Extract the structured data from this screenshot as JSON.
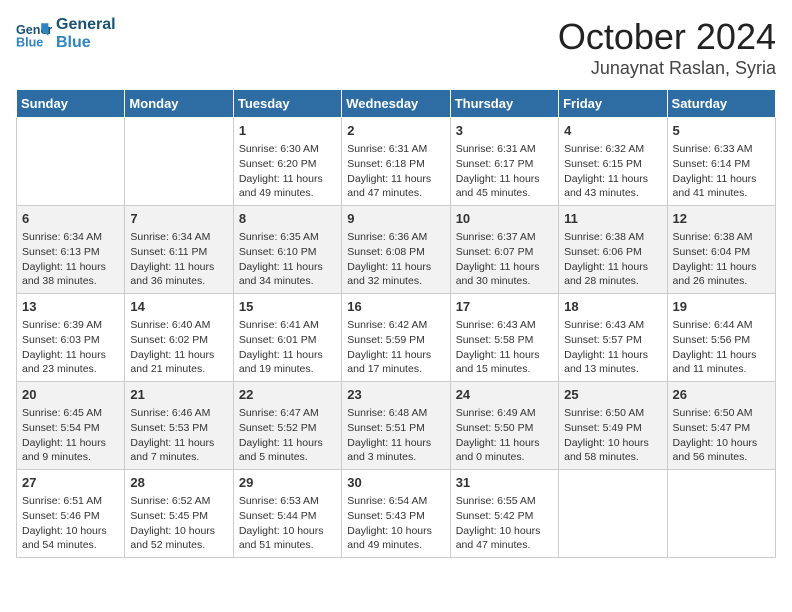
{
  "header": {
    "logo_line1": "General",
    "logo_line2": "Blue",
    "month": "October 2024",
    "location": "Junaynat Raslan, Syria"
  },
  "columns": [
    "Sunday",
    "Monday",
    "Tuesday",
    "Wednesday",
    "Thursday",
    "Friday",
    "Saturday"
  ],
  "weeks": [
    [
      {
        "day": "",
        "empty": true
      },
      {
        "day": "",
        "empty": true
      },
      {
        "day": "1",
        "sunrise": "Sunrise: 6:30 AM",
        "sunset": "Sunset: 6:20 PM",
        "daylight": "Daylight: 11 hours and 49 minutes."
      },
      {
        "day": "2",
        "sunrise": "Sunrise: 6:31 AM",
        "sunset": "Sunset: 6:18 PM",
        "daylight": "Daylight: 11 hours and 47 minutes."
      },
      {
        "day": "3",
        "sunrise": "Sunrise: 6:31 AM",
        "sunset": "Sunset: 6:17 PM",
        "daylight": "Daylight: 11 hours and 45 minutes."
      },
      {
        "day": "4",
        "sunrise": "Sunrise: 6:32 AM",
        "sunset": "Sunset: 6:15 PM",
        "daylight": "Daylight: 11 hours and 43 minutes."
      },
      {
        "day": "5",
        "sunrise": "Sunrise: 6:33 AM",
        "sunset": "Sunset: 6:14 PM",
        "daylight": "Daylight: 11 hours and 41 minutes."
      }
    ],
    [
      {
        "day": "6",
        "sunrise": "Sunrise: 6:34 AM",
        "sunset": "Sunset: 6:13 PM",
        "daylight": "Daylight: 11 hours and 38 minutes."
      },
      {
        "day": "7",
        "sunrise": "Sunrise: 6:34 AM",
        "sunset": "Sunset: 6:11 PM",
        "daylight": "Daylight: 11 hours and 36 minutes."
      },
      {
        "day": "8",
        "sunrise": "Sunrise: 6:35 AM",
        "sunset": "Sunset: 6:10 PM",
        "daylight": "Daylight: 11 hours and 34 minutes."
      },
      {
        "day": "9",
        "sunrise": "Sunrise: 6:36 AM",
        "sunset": "Sunset: 6:08 PM",
        "daylight": "Daylight: 11 hours and 32 minutes."
      },
      {
        "day": "10",
        "sunrise": "Sunrise: 6:37 AM",
        "sunset": "Sunset: 6:07 PM",
        "daylight": "Daylight: 11 hours and 30 minutes."
      },
      {
        "day": "11",
        "sunrise": "Sunrise: 6:38 AM",
        "sunset": "Sunset: 6:06 PM",
        "daylight": "Daylight: 11 hours and 28 minutes."
      },
      {
        "day": "12",
        "sunrise": "Sunrise: 6:38 AM",
        "sunset": "Sunset: 6:04 PM",
        "daylight": "Daylight: 11 hours and 26 minutes."
      }
    ],
    [
      {
        "day": "13",
        "sunrise": "Sunrise: 6:39 AM",
        "sunset": "Sunset: 6:03 PM",
        "daylight": "Daylight: 11 hours and 23 minutes."
      },
      {
        "day": "14",
        "sunrise": "Sunrise: 6:40 AM",
        "sunset": "Sunset: 6:02 PM",
        "daylight": "Daylight: 11 hours and 21 minutes."
      },
      {
        "day": "15",
        "sunrise": "Sunrise: 6:41 AM",
        "sunset": "Sunset: 6:01 PM",
        "daylight": "Daylight: 11 hours and 19 minutes."
      },
      {
        "day": "16",
        "sunrise": "Sunrise: 6:42 AM",
        "sunset": "Sunset: 5:59 PM",
        "daylight": "Daylight: 11 hours and 17 minutes."
      },
      {
        "day": "17",
        "sunrise": "Sunrise: 6:43 AM",
        "sunset": "Sunset: 5:58 PM",
        "daylight": "Daylight: 11 hours and 15 minutes."
      },
      {
        "day": "18",
        "sunrise": "Sunrise: 6:43 AM",
        "sunset": "Sunset: 5:57 PM",
        "daylight": "Daylight: 11 hours and 13 minutes."
      },
      {
        "day": "19",
        "sunrise": "Sunrise: 6:44 AM",
        "sunset": "Sunset: 5:56 PM",
        "daylight": "Daylight: 11 hours and 11 minutes."
      }
    ],
    [
      {
        "day": "20",
        "sunrise": "Sunrise: 6:45 AM",
        "sunset": "Sunset: 5:54 PM",
        "daylight": "Daylight: 11 hours and 9 minutes."
      },
      {
        "day": "21",
        "sunrise": "Sunrise: 6:46 AM",
        "sunset": "Sunset: 5:53 PM",
        "daylight": "Daylight: 11 hours and 7 minutes."
      },
      {
        "day": "22",
        "sunrise": "Sunrise: 6:47 AM",
        "sunset": "Sunset: 5:52 PM",
        "daylight": "Daylight: 11 hours and 5 minutes."
      },
      {
        "day": "23",
        "sunrise": "Sunrise: 6:48 AM",
        "sunset": "Sunset: 5:51 PM",
        "daylight": "Daylight: 11 hours and 3 minutes."
      },
      {
        "day": "24",
        "sunrise": "Sunrise: 6:49 AM",
        "sunset": "Sunset: 5:50 PM",
        "daylight": "Daylight: 11 hours and 0 minutes."
      },
      {
        "day": "25",
        "sunrise": "Sunrise: 6:50 AM",
        "sunset": "Sunset: 5:49 PM",
        "daylight": "Daylight: 10 hours and 58 minutes."
      },
      {
        "day": "26",
        "sunrise": "Sunrise: 6:50 AM",
        "sunset": "Sunset: 5:47 PM",
        "daylight": "Daylight: 10 hours and 56 minutes."
      }
    ],
    [
      {
        "day": "27",
        "sunrise": "Sunrise: 6:51 AM",
        "sunset": "Sunset: 5:46 PM",
        "daylight": "Daylight: 10 hours and 54 minutes."
      },
      {
        "day": "28",
        "sunrise": "Sunrise: 6:52 AM",
        "sunset": "Sunset: 5:45 PM",
        "daylight": "Daylight: 10 hours and 52 minutes."
      },
      {
        "day": "29",
        "sunrise": "Sunrise: 6:53 AM",
        "sunset": "Sunset: 5:44 PM",
        "daylight": "Daylight: 10 hours and 51 minutes."
      },
      {
        "day": "30",
        "sunrise": "Sunrise: 6:54 AM",
        "sunset": "Sunset: 5:43 PM",
        "daylight": "Daylight: 10 hours and 49 minutes."
      },
      {
        "day": "31",
        "sunrise": "Sunrise: 6:55 AM",
        "sunset": "Sunset: 5:42 PM",
        "daylight": "Daylight: 10 hours and 47 minutes."
      },
      {
        "day": "",
        "empty": true
      },
      {
        "day": "",
        "empty": true
      }
    ]
  ]
}
